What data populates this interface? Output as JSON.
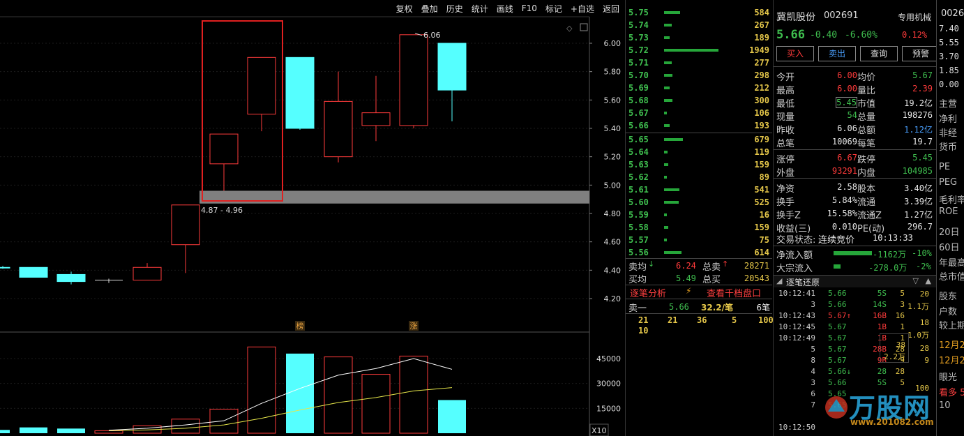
{
  "toolbar": {
    "items": [
      "复权",
      "叠加",
      "历史",
      "统计",
      "画线",
      "F10",
      "标记",
      "+自选",
      "返回"
    ]
  },
  "colors": {
    "up": "#ff3b3b",
    "down": "#55ffff",
    "ma_white": "#ffffff",
    "ma_yellow": "#e6e64a",
    "zone": "#7f7f7f",
    "highlight_box": "#e02020"
  },
  "chart_data": {
    "type": "candlestick",
    "price_axis_ticks": [
      "6.00",
      "5.80",
      "5.60",
      "5.40",
      "5.20",
      "5.00",
      "4.80",
      "4.60",
      "4.40",
      "4.20"
    ],
    "volume_axis_ticks": [
      "45000",
      "30000",
      "15000"
    ],
    "volume_unit_label": "X10",
    "max_marker_label": "6.06",
    "zone_label": "4.87 - 4.96",
    "zone_range": [
      4.87,
      4.96
    ],
    "candles": [
      {
        "o": 4.42,
        "h": 4.43,
        "l": 4.41,
        "c": 4.42,
        "dir": "down"
      },
      {
        "o": 4.42,
        "h": 4.42,
        "l": 4.35,
        "c": 4.35,
        "dir": "down"
      },
      {
        "o": 4.37,
        "h": 4.39,
        "l": 4.3,
        "c": 4.32,
        "dir": "down"
      },
      {
        "o": 4.33,
        "h": 4.34,
        "l": 4.31,
        "c": 4.33,
        "dir": "flat"
      },
      {
        "o": 4.33,
        "h": 4.45,
        "l": 4.33,
        "c": 4.42,
        "dir": "up"
      },
      {
        "o": 4.58,
        "h": 4.86,
        "l": 4.38,
        "c": 4.86,
        "dir": "up"
      },
      {
        "o": 5.15,
        "h": 5.35,
        "l": 4.96,
        "c": 5.36,
        "dir": "up"
      },
      {
        "o": 5.5,
        "h": 5.9,
        "l": 5.38,
        "c": 5.9,
        "dir": "up"
      },
      {
        "o": 5.9,
        "h": 5.9,
        "l": 5.39,
        "c": 5.4,
        "dir": "down"
      },
      {
        "o": 5.2,
        "h": 5.8,
        "l": 5.16,
        "c": 5.59,
        "dir": "up"
      },
      {
        "o": 5.42,
        "h": 5.77,
        "l": 5.31,
        "c": 5.51,
        "dir": "up"
      },
      {
        "o": 5.42,
        "h": 6.06,
        "l": 5.4,
        "c": 6.06,
        "dir": "up"
      },
      {
        "o": 6.0,
        "h": 6.0,
        "l": 5.45,
        "c": 5.67,
        "dir": "down"
      }
    ],
    "volumes": [
      2000,
      3500,
      2800,
      1500,
      4500,
      8500,
      14500,
      52000,
      48000,
      46000,
      35500,
      46500,
      20000
    ],
    "ma_white": [
      null,
      null,
      null,
      1800,
      3000,
      5000,
      7500,
      18000,
      27000,
      35000,
      39000,
      45000,
      38500
    ],
    "ma_yellow": [
      null,
      null,
      null,
      1500,
      2000,
      3000,
      5000,
      9000,
      14000,
      18500,
      21500,
      25500,
      27500
    ],
    "markers": [
      {
        "candle": 8,
        "text": "榜"
      },
      {
        "candle": 11,
        "text": "涨"
      }
    ]
  },
  "orderbook": {
    "asks": [
      {
        "price": "5.75",
        "vol": "584"
      },
      {
        "price": "5.74",
        "vol": "267"
      },
      {
        "price": "5.73",
        "vol": "189"
      },
      {
        "price": "5.72",
        "vol": "1949"
      },
      {
        "price": "5.71",
        "vol": "277"
      },
      {
        "price": "5.70",
        "vol": "298"
      },
      {
        "price": "5.69",
        "vol": "212"
      },
      {
        "price": "5.68",
        "vol": "300"
      },
      {
        "price": "5.67",
        "vol": "106"
      },
      {
        "price": "5.66",
        "vol": "193"
      }
    ],
    "bids": [
      {
        "price": "5.65",
        "vol": "679"
      },
      {
        "price": "5.64",
        "vol": "119"
      },
      {
        "price": "5.63",
        "vol": "159"
      },
      {
        "price": "5.62",
        "vol": "89"
      },
      {
        "price": "5.61",
        "vol": "541"
      },
      {
        "price": "5.60",
        "vol": "525"
      },
      {
        "price": "5.59",
        "vol": "16"
      },
      {
        "price": "5.58",
        "vol": "159"
      },
      {
        "price": "5.57",
        "vol": "75"
      },
      {
        "price": "5.56",
        "vol": "614"
      }
    ],
    "summary": {
      "sell_avg_label": "卖均",
      "sell_avg": "6.24",
      "total_sell_label": "总卖",
      "total_sell": "28271",
      "buy_avg_label": "买均",
      "buy_avg": "5.49",
      "total_buy_label": "总买",
      "total_buy": "20543"
    },
    "links": {
      "tick_analysis": "逐笔分析",
      "thousand_book": "查看千档盘口"
    },
    "sell1": {
      "label": "卖一",
      "price": "5.66",
      "avg": "32.2/笔",
      "count": "6笔"
    },
    "queue": [
      "21",
      "21",
      "36",
      "5",
      "100",
      "10"
    ]
  },
  "quote": {
    "name": "冀凯股份",
    "code": "002691",
    "tag": "专用机械",
    "price": "5.66",
    "change": "-0.40",
    "change_pct": "-6.60%",
    "extra_pct": "0.12%",
    "buttons": [
      "买入",
      "卖出",
      "查询",
      "预警"
    ],
    "rows": [
      {
        "l1": "今开",
        "v1": "6.00",
        "c1": "red",
        "l2": "均价",
        "v2": "5.67",
        "c2": "green"
      },
      {
        "l1": "最高",
        "v1": "6.00",
        "c1": "red",
        "l2": "量比",
        "v2": "2.39",
        "c2": "red"
      },
      {
        "l1": "最低",
        "v1": "5.45",
        "c1": "green",
        "l2": "市值",
        "v2": "19.2亿",
        "c2": "white"
      },
      {
        "l1": "现量",
        "v1": "54",
        "c1": "green",
        "l2": "总量",
        "v2": "198276",
        "c2": "white"
      },
      {
        "l1": "昨收",
        "v1": "6.06",
        "c1": "white",
        "l2": "总额",
        "v2": "1.12亿",
        "c2": "blue"
      },
      {
        "l1": "总笔",
        "v1": "10069",
        "c1": "white",
        "l2": "每笔",
        "v2": "19.7",
        "c2": "white"
      },
      {
        "l1": "涨停",
        "v1": "6.67",
        "c1": "red",
        "l2": "跌停",
        "v2": "5.45",
        "c2": "green"
      },
      {
        "l1": "外盘",
        "v1": "93291",
        "c1": "red",
        "l2": "内盘",
        "v2": "104985",
        "c2": "green"
      },
      {
        "l1": "净资",
        "v1": "2.58",
        "c1": "white",
        "l2": "股本",
        "v2": "3.40亿",
        "c2": "white"
      },
      {
        "l1": "换手",
        "v1": "5.84%",
        "c1": "white",
        "l2": "流通",
        "v2": "3.39亿",
        "c2": "white"
      },
      {
        "l1": "换手Z",
        "v1": "15.58%",
        "c1": "white",
        "l2": "流通Z",
        "v2": "1.27亿",
        "c2": "white"
      },
      {
        "l1": "收益(三)",
        "v1": "0.010",
        "c1": "white",
        "l2": "PE(动)",
        "v2": "296.7",
        "c2": "white"
      }
    ],
    "trade_status_label": "交易状态:",
    "trade_status": "连续竞价",
    "trade_time": "10:13:33",
    "net_inflow_label": "净流入额",
    "net_inflow": "-1162万",
    "net_inflow_pct": "-10%",
    "block_inflow_label": "大宗流入",
    "block_inflow": "-278.0万",
    "block_inflow_pct": "-2%",
    "tick_title": "逐笔还原",
    "ticks": [
      {
        "t": "10:12:41",
        "p": "5.66",
        "pc": "green",
        "v": "5S",
        "vc": "green",
        "o": "5"
      },
      {
        "t": "3",
        "p": "5.66",
        "pc": "green",
        "v": "14S",
        "vc": "green",
        "o": "3"
      },
      {
        "t": "10:12:43",
        "p": "5.67↑",
        "pc": "red",
        "v": "16B",
        "vc": "red",
        "o": "16"
      },
      {
        "t": "10:12:45",
        "p": "5.67",
        "pc": "green",
        "v": "1B",
        "vc": "red",
        "o": "1"
      },
      {
        "t": "10:12:49",
        "p": "5.67",
        "pc": "green",
        "v": "1B",
        "vc": "red",
        "o": "1"
      },
      {
        "t": "5",
        "p": "5.67",
        "pc": "green",
        "v": "28B",
        "vc": "red",
        "o": "28"
      },
      {
        "t": "8",
        "p": "5.67",
        "pc": "green",
        "v": "9B",
        "vc": "red",
        "o": "9"
      },
      {
        "t": "4",
        "p": "5.66↓",
        "pc": "green",
        "v": "28",
        "vc": "green",
        "o": "28"
      },
      {
        "t": "3",
        "p": "5.66",
        "pc": "green",
        "v": "5S",
        "vc": "green",
        "o": "5"
      },
      {
        "t": "6",
        "p": "5.65",
        "pc": "green",
        "v": "",
        "vc": "green",
        "o": ""
      },
      {
        "t": "7",
        "p": "5.65",
        "pc": "green",
        "v": "",
        "vc": "green",
        "o": ""
      },
      {
        "t": "",
        "p": "",
        "pc": "green",
        "v": "",
        "vc": "green",
        "o": ""
      },
      {
        "t": "10:12:50",
        "p": "",
        "pc": "green",
        "v": "",
        "vc": "green",
        "o": ""
      }
    ],
    "tick_side_values": [
      "20",
      "1.1万",
      "18",
      "1.0万",
      "28",
      "9",
      "100"
    ],
    "tick_box": {
      "top": "38",
      "bottom": "2.2万"
    }
  },
  "side": {
    "code_prefix": "0026",
    "values": [
      "7.40",
      "5.55",
      "3.70",
      "1.85",
      "0.00"
    ],
    "items": [
      "主营",
      "净利",
      "非经",
      "货币",
      "PE",
      "PEG",
      "毛利率",
      "ROE",
      "20日",
      "60日",
      "年最高",
      "总市值",
      "股东",
      "户数",
      "较上期",
      "12月2",
      "12月2",
      "眼光",
      "看多 5",
      "10"
    ]
  },
  "watermark": {
    "text": "万股网",
    "url": "www.201082.com"
  }
}
